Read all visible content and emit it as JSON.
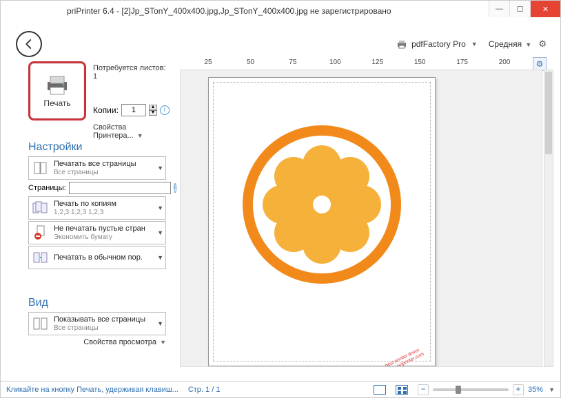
{
  "window": {
    "title": "priPrinter 6.4 - [2]Jp_STonY_400x400.jpg,Jp_STonY_400x400.jpg не зарегистрировано"
  },
  "toolbar": {
    "printer_name": "pdfFactory Pro",
    "quality": "Средняя"
  },
  "ruler": {
    "marks": [
      "25",
      "50",
      "75",
      "100",
      "125",
      "150",
      "175",
      "200"
    ]
  },
  "print": {
    "button_label": "Печать",
    "sheets_label": "Потребуется листов: 1",
    "copies_label": "Копии:",
    "copies_value": "1",
    "printer_props": "Свойства Принтера..."
  },
  "settings": {
    "header": "Настройки",
    "all_pages": {
      "title": "Печатать все страницы",
      "sub": "Все страницы"
    },
    "pages_label": "Страницы:",
    "pages_value": "",
    "by_copies": {
      "title": "Печать по копиям",
      "sub": "1,2,3  1,2,3  1,2,3"
    },
    "no_empty": {
      "title": "Не печатать пустые стран",
      "sub": "Экономить бумагу"
    },
    "normal": {
      "title": "Печатать в обычном пор."
    }
  },
  "view": {
    "header": "Вид",
    "show_all": {
      "title": "Показывать все страницы",
      "sub": "Все страницы"
    },
    "props": "Свойства просмотра"
  },
  "status": {
    "message": "Кликайте на кнопку Печать, удерживая клавиш...",
    "page": "Стр. 1 / 1",
    "zoom": "35%"
  },
  "watermark": {
    "line1": "priPrinter - best printer driver",
    "line2": "please visit www.priprinter.com"
  }
}
